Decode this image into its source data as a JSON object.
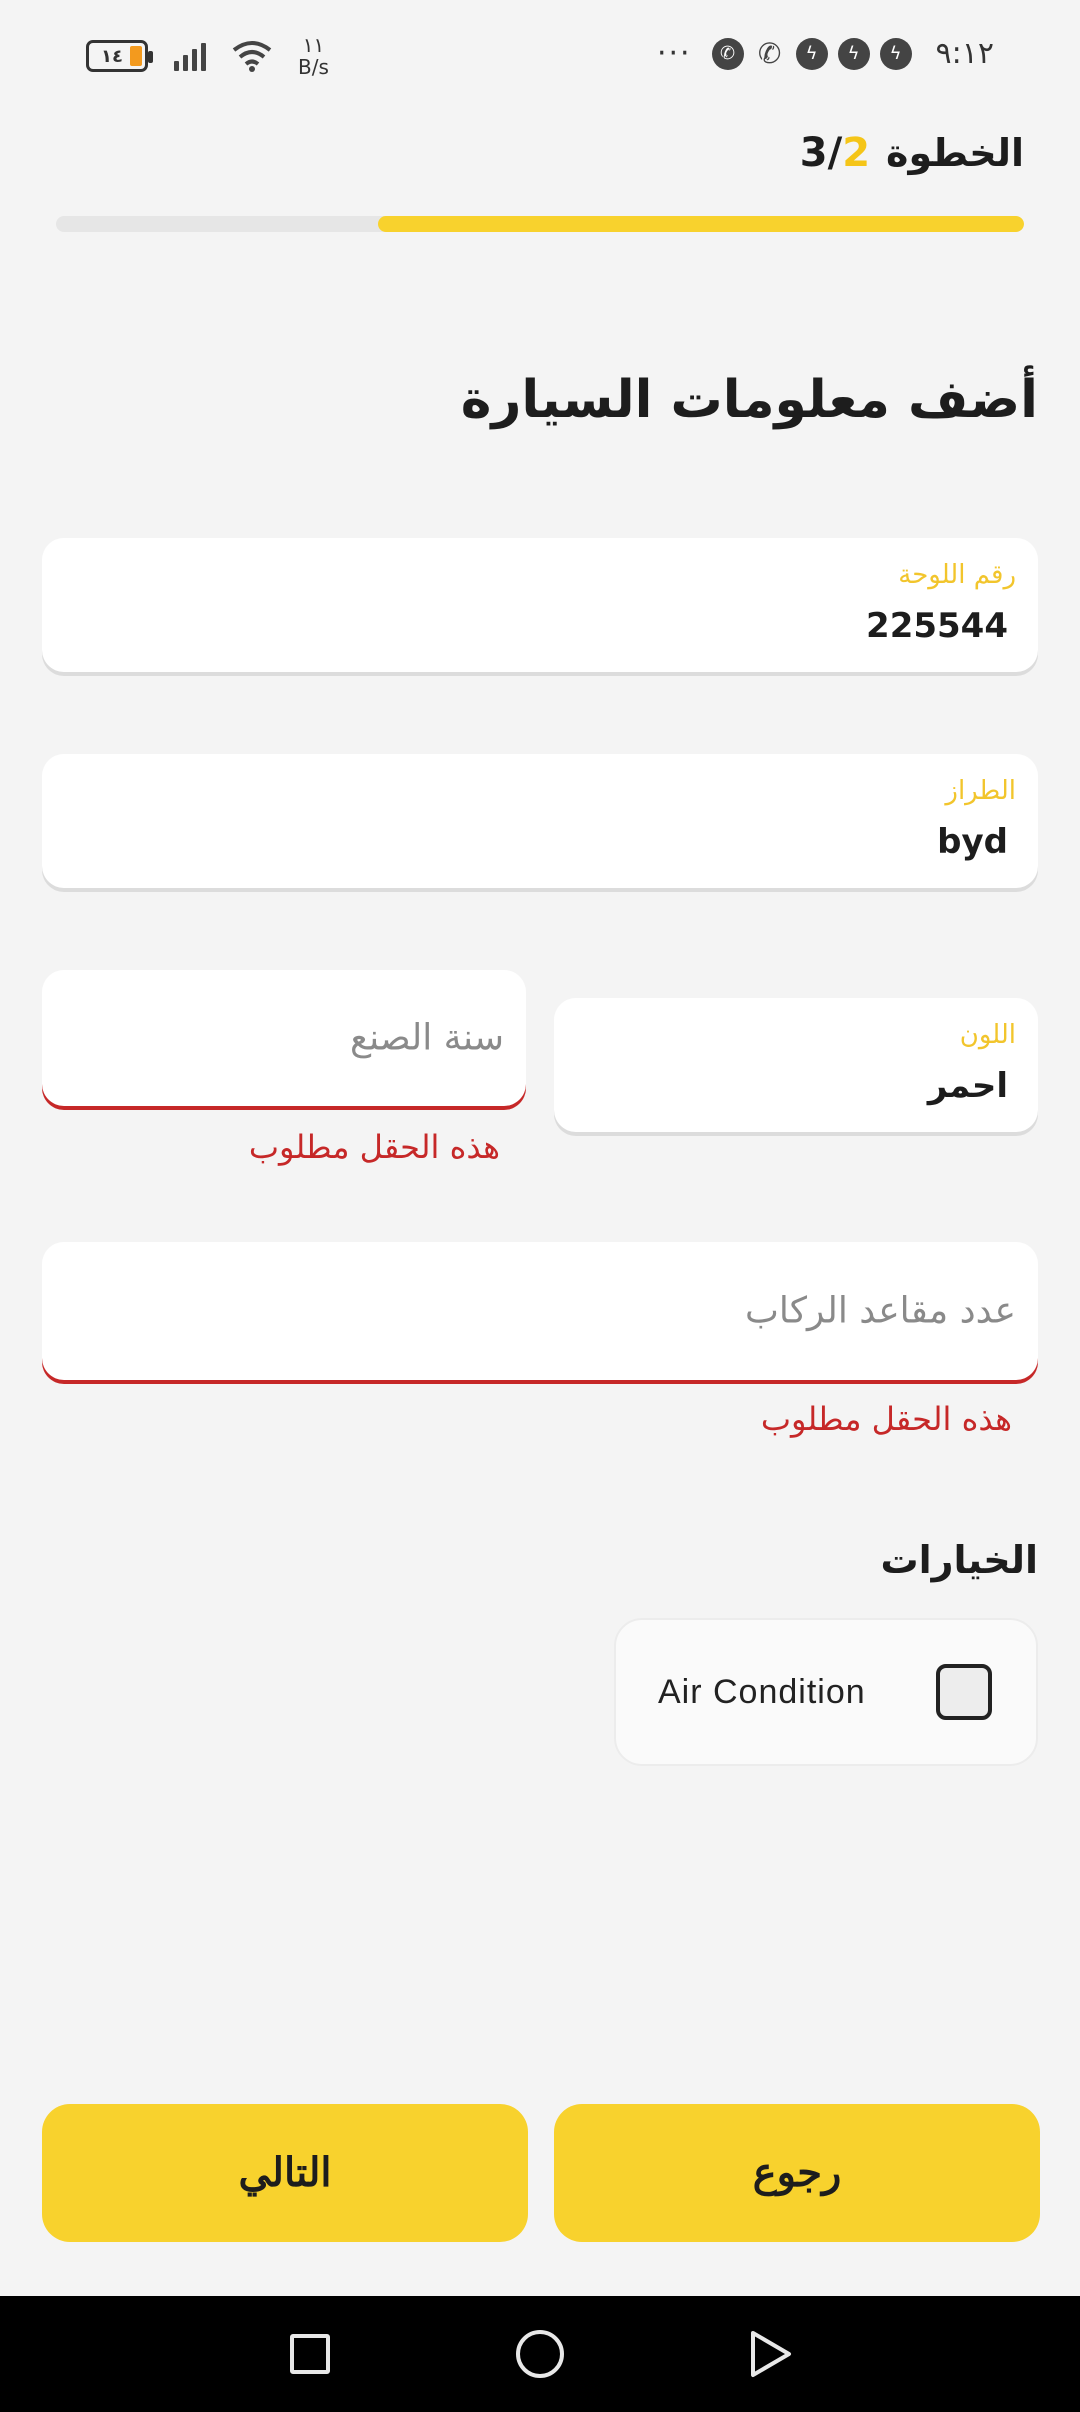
{
  "status_bar": {
    "battery_level": "١٤",
    "net_speed_value": "١١",
    "net_speed_unit": "B/s",
    "more_indicator": "···",
    "time": "٩:١٢",
    "notification_icons": [
      "whatsapp-icon",
      "call-forward-icon",
      "messenger-icon",
      "messenger-icon",
      "messenger-icon"
    ]
  },
  "header": {
    "step_label": "الخطوة",
    "step_current": "2",
    "step_separator": "/",
    "step_total": "3",
    "progress": 0.667,
    "accent_color": "#f8d22d"
  },
  "form": {
    "title": "أضف معلومات السيارة",
    "plate": {
      "label": "رقم اللوحة",
      "value": "225544"
    },
    "model": {
      "label": "الطراز",
      "value": "byd"
    },
    "color": {
      "label": "اللون",
      "value": "احمر"
    },
    "year": {
      "placeholder": "سنة الصنع",
      "error": "هذه الحقل مطلوب"
    },
    "seats": {
      "placeholder": "عدد مقاعد الركاب",
      "error": "هذه الحقل مطلوب"
    },
    "error_color": "#c62828"
  },
  "options": {
    "title": "الخيارات",
    "items": [
      {
        "label": "Air Condition",
        "checked": false
      }
    ]
  },
  "buttons": {
    "back": "رجوع",
    "next": "التالي"
  }
}
